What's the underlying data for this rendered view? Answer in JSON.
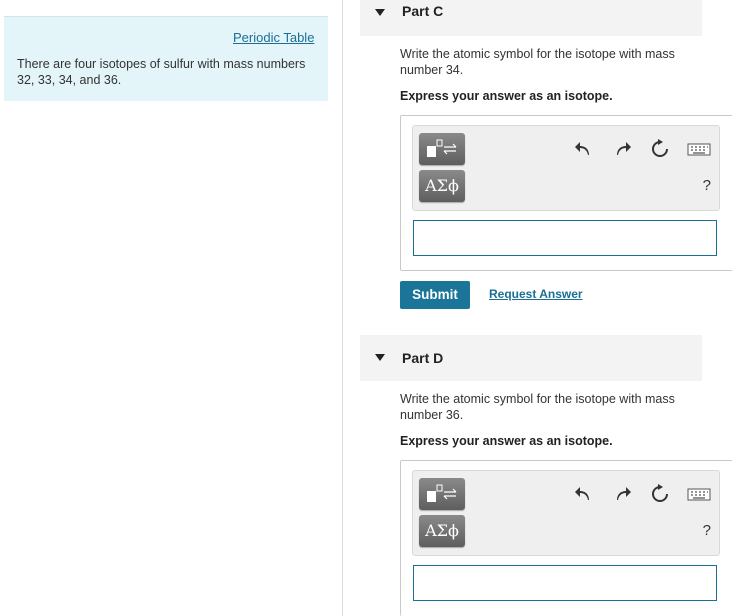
{
  "sidebar": {
    "link": "Periodic Table",
    "intro": "There are four isotopes of sulfur with mass numbers 32, 33, 34, and 36."
  },
  "partC": {
    "title": "Part C",
    "question": "Write the atomic symbol for the isotope with mass number 34.",
    "instruction": "Express your answer as an isotope.",
    "greek_button": "ΑΣϕ",
    "help": "?",
    "answer_value": "",
    "submit": "Submit",
    "request": "Request Answer"
  },
  "partD": {
    "title": "Part D",
    "question": "Write the atomic symbol for the isotope with mass number 36.",
    "instruction": "Express your answer as an isotope.",
    "greek_button": "ΑΣϕ",
    "help": "?",
    "answer_value": ""
  },
  "icons": [
    "caret-down-icon",
    "template-icon",
    "undo-icon",
    "redo-icon",
    "reset-icon",
    "keyboard-icon"
  ],
  "colors": {
    "accent": "#1a7599",
    "link": "#1a6f96",
    "panel": "#e3f5f8"
  }
}
